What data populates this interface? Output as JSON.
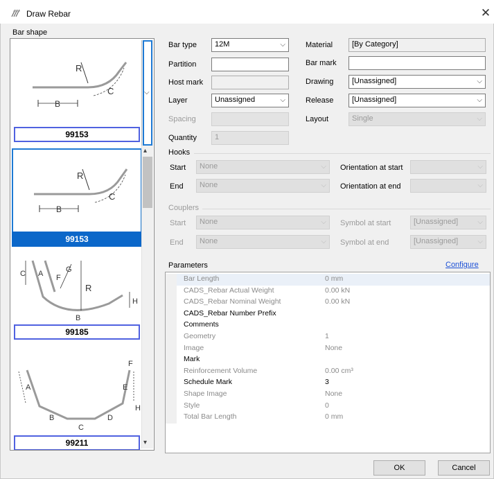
{
  "window": {
    "title": "Draw Rebar",
    "close_glyph": "✕"
  },
  "shape_group_label": "Bar shape",
  "shapes": [
    {
      "id": "99153",
      "selected": false,
      "dims": [
        "R",
        "B",
        "C"
      ]
    },
    {
      "id": "99153",
      "selected": true,
      "dims": [
        "R",
        "B",
        "C"
      ]
    },
    {
      "id": "99185",
      "selected": false,
      "dims": [
        "C",
        "A",
        "F",
        "G",
        "R",
        "H",
        "B"
      ]
    },
    {
      "id": "99211",
      "selected": false,
      "dims": [
        "A",
        "B",
        "C",
        "D",
        "E",
        "F",
        "H"
      ]
    }
  ],
  "form": {
    "bar_type": {
      "label": "Bar type",
      "value": "12M"
    },
    "partition": {
      "label": "Partition",
      "value": ""
    },
    "host_mark": {
      "label": "Host mark",
      "value": ""
    },
    "layer": {
      "label": "Layer",
      "value": "Unassigned"
    },
    "spacing": {
      "label": "Spacing",
      "value": ""
    },
    "quantity": {
      "label": "Quantity",
      "value": "1"
    },
    "material": {
      "label": "Material",
      "value": "[By Category]"
    },
    "bar_mark": {
      "label": "Bar mark",
      "value": ""
    },
    "drawing": {
      "label": "Drawing",
      "value": "[Unassigned]"
    },
    "release": {
      "label": "Release",
      "value": "[Unassigned]"
    },
    "layout": {
      "label": "Layout",
      "value": "Single"
    }
  },
  "hooks": {
    "title": "Hooks",
    "start_label": "Start",
    "start_value": "None",
    "end_label": "End",
    "end_value": "None",
    "orient_start_label": "Orientation at start",
    "orient_start_value": "",
    "orient_end_label": "Orientation at end",
    "orient_end_value": ""
  },
  "couplers": {
    "title": "Couplers",
    "start_label": "Start",
    "start_value": "None",
    "end_label": "End",
    "end_value": "None",
    "symbol_start_label": "Symbol at start",
    "symbol_start_value": "[Unassigned]",
    "symbol_end_label": "Symbol at end",
    "symbol_end_value": "[Unassigned]"
  },
  "parameters": {
    "title": "Parameters",
    "configure_link": "Configure",
    "rows": [
      {
        "name": "Bar Length",
        "value": "0 mm",
        "dim": true
      },
      {
        "name": "CADS_Rebar Actual Weight",
        "value": "0.00 kN",
        "dim": true
      },
      {
        "name": "CADS_Rebar Nominal Weight",
        "value": "0.00 kN",
        "dim": true
      },
      {
        "name": "CADS_Rebar Number Prefix",
        "value": "",
        "dim": false
      },
      {
        "name": "Comments",
        "value": "",
        "dim": false
      },
      {
        "name": "Geometry",
        "value": "1",
        "dim": true
      },
      {
        "name": "Image",
        "value": "None",
        "dim": true
      },
      {
        "name": "Mark",
        "value": "",
        "dim": false
      },
      {
        "name": "Reinforcement Volume",
        "value": "0.00 cm³",
        "dim": true
      },
      {
        "name": "Schedule Mark",
        "value": "3",
        "dim": false
      },
      {
        "name": "Shape Image",
        "value": "None",
        "dim": true
      },
      {
        "name": "Style",
        "value": "0",
        "dim": true
      },
      {
        "name": "Total Bar Length",
        "value": "0 mm",
        "dim": true
      }
    ]
  },
  "buttons": {
    "ok": "OK",
    "cancel": "Cancel"
  },
  "icons": {
    "title_icon": "rebar-icon",
    "chevron": "⌵",
    "scroll_up": "▴",
    "scroll_down": "▾"
  }
}
